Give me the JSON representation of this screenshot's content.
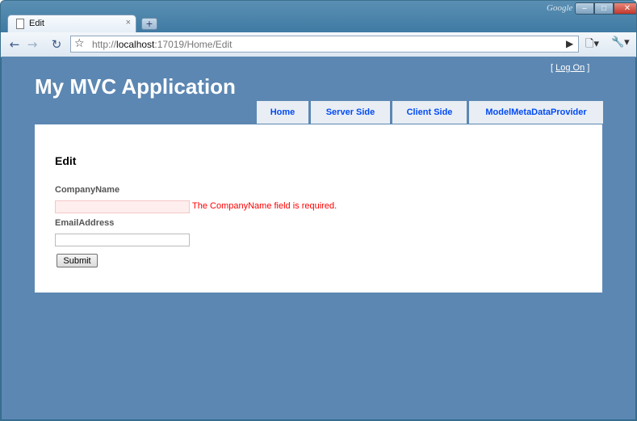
{
  "browser": {
    "tab_title": "Edit",
    "tab_close": "×",
    "new_tab": "+",
    "brand_label": "Google",
    "window_buttons": {
      "minimize": "–",
      "maximize": "□",
      "close": "✕"
    },
    "url_prefix": "http://",
    "url_host": "localhost",
    "url_rest": ":17019/Home/Edit"
  },
  "page": {
    "logon_open": "[ ",
    "logon_link": "Log On",
    "logon_close": " ]",
    "app_title": "My MVC Application",
    "menu": [
      {
        "label": "Home"
      },
      {
        "label": "Server Side"
      },
      {
        "label": "Client Side"
      },
      {
        "label": "ModelMetaDataProvider"
      }
    ],
    "form": {
      "heading": "Edit",
      "company_label": "CompanyName",
      "company_value": "",
      "company_error": "The CompanyName field is required.",
      "email_label": "EmailAddress",
      "email_value": "",
      "submit_label": "Submit"
    }
  }
}
